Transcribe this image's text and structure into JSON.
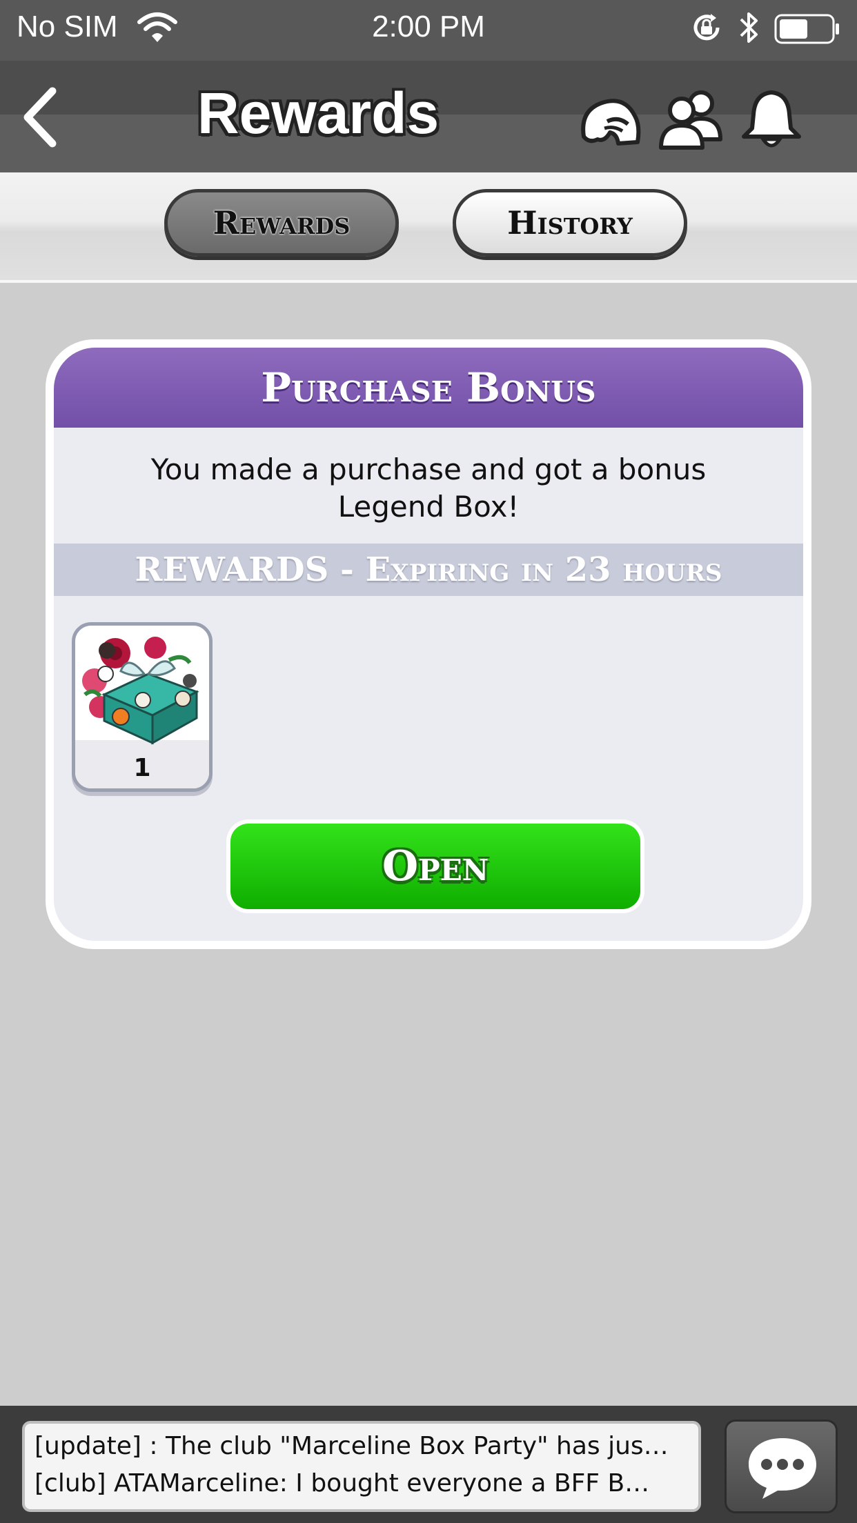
{
  "status_bar": {
    "carrier": "No SIM",
    "time": "2:00 PM",
    "battery_level": 0.5
  },
  "nav": {
    "title": "Rewards",
    "icons": [
      "back-chevron-icon",
      "player-head-icon",
      "friends-icon",
      "bell-icon"
    ]
  },
  "tabs": [
    {
      "label": "Rewards",
      "active": true
    },
    {
      "label": "History",
      "active": false
    }
  ],
  "card": {
    "header": "Purchase Bonus",
    "message_line1": "You made a purchase and got a bonus",
    "message_line2": "Legend Box!",
    "band": "REWARDS - Expiring in 23 hours",
    "item": {
      "image": "legend-box-icon",
      "quantity": "1"
    },
    "open_label": "Open"
  },
  "chat": {
    "lines": [
      "[update] : The club \"Marceline Box Party\" has jus…",
      "[club] ATAMarceline: I bought everyone a BFF B…"
    ],
    "button_icon": "chat-bubble-icon"
  },
  "colors": {
    "header_purple": "#7f5cb4",
    "open_green": "#1ec80a",
    "background": "#cdcdcd"
  }
}
